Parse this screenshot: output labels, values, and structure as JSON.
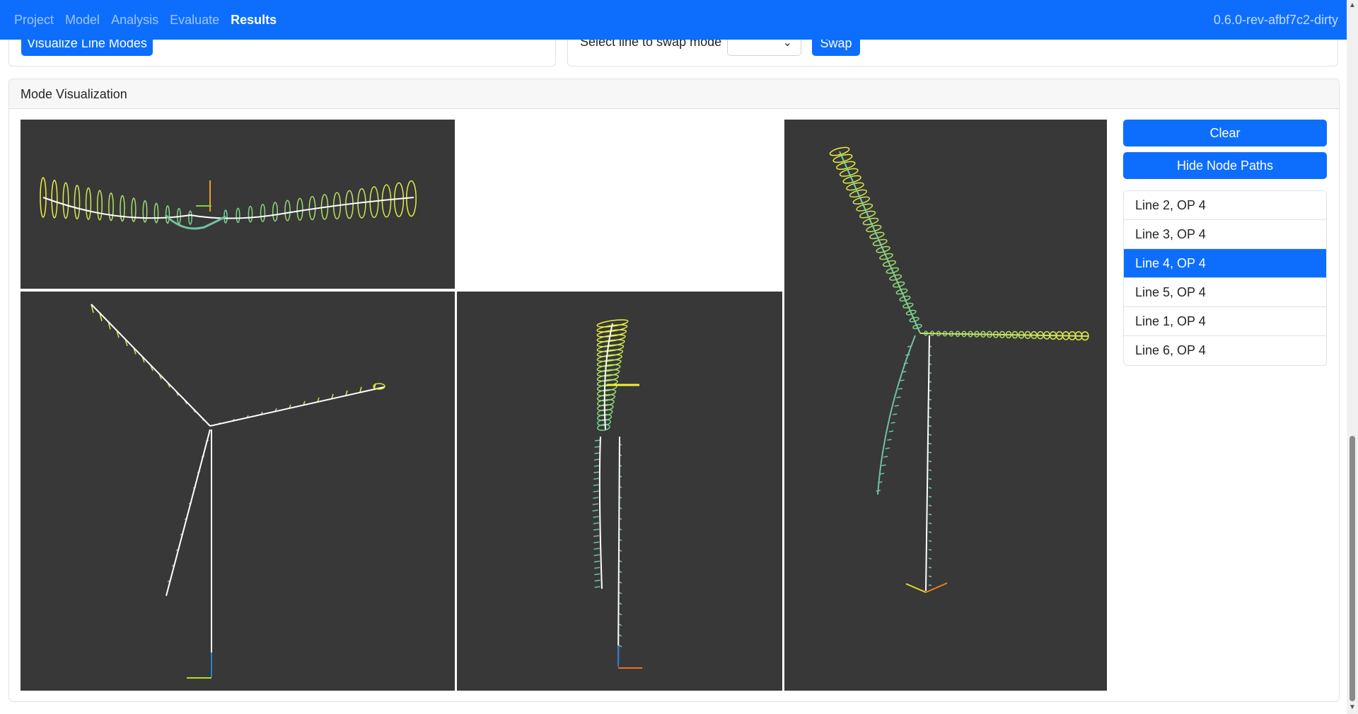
{
  "navbar": {
    "links": [
      "Project",
      "Model",
      "Analysis",
      "Evaluate",
      "Results"
    ],
    "active_link": "Results",
    "version": "0.6.0-rev-afbf7c2-dirty"
  },
  "controls": {
    "visualize_button": "Visualize Line Modes",
    "swap_label": "Select line to swap mode",
    "swap_select_value": "",
    "swap_button": "Swap"
  },
  "mode_visualization": {
    "title": "Mode Visualization",
    "clear_button": "Clear",
    "hide_paths_button": "Hide Node Paths",
    "lines": [
      {
        "label": "Line 2, OP 4",
        "active": false
      },
      {
        "label": "Line 3, OP 4",
        "active": false
      },
      {
        "label": "Line 4, OP 4",
        "active": true
      },
      {
        "label": "Line 5, OP 4",
        "active": false
      },
      {
        "label": "Line 1, OP 4",
        "active": false
      },
      {
        "label": "Line 6, OP 4",
        "active": false
      }
    ]
  },
  "colors": {
    "primary": "#0d6efd",
    "viewport_bg": "#383838",
    "mode_near": "#6fcf8f",
    "mode_far": "#f0f03c",
    "structure": "#ffffff"
  }
}
